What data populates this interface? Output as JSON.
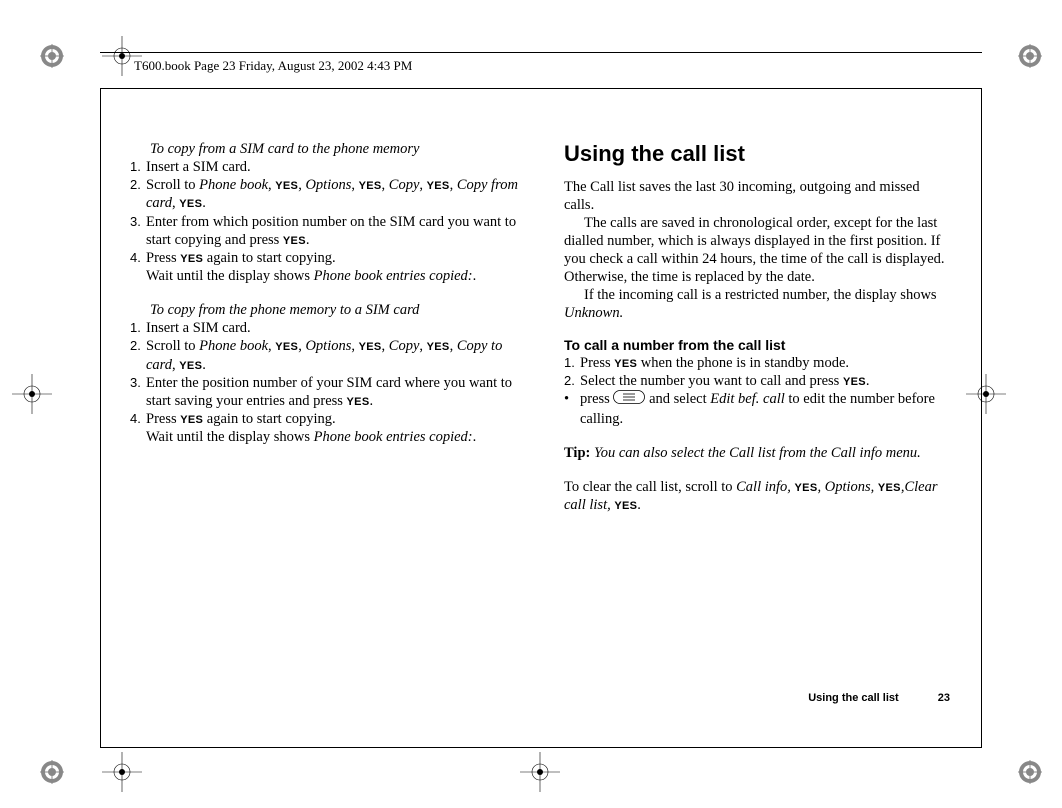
{
  "header": {
    "text": "T600.book  Page 23  Friday, August 23, 2002  4:43 PM"
  },
  "left_col": {
    "sec1": {
      "title": "To copy from a SIM card to the phone memory",
      "step1": "Insert a SIM card.",
      "step2_a": "Scroll to ",
      "step2_pb": "Phone book",
      "step2_b": ", ",
      "step2_opt": "Options",
      "step2_c": ", ",
      "step2_copy": "Copy",
      "step2_d": ", ",
      "step2_cfc": "Copy from card",
      "step2_e": ", ",
      "step2_f": ".",
      "step3_a": "Enter from which position number on the SIM card you want to start copying and press ",
      "step3_b": ".",
      "step4_a": "Press ",
      "step4_b": " again to start copying.",
      "step4_c": "Wait until the display shows ",
      "step4_d": "Phone book entries copied:",
      "step4_e": "."
    },
    "sec2": {
      "title": "To copy from the phone memory to a SIM card",
      "step1": "Insert a SIM card.",
      "step2_a": "Scroll to ",
      "step2_pb": "Phone book",
      "step2_b": ", ",
      "step2_opt": "Options",
      "step2_c": ", ",
      "step2_copy": "Copy",
      "step2_d": ", ",
      "step2_ctc": "Copy to card",
      "step2_e": ", ",
      "step2_f": ".",
      "step3_a": "Enter the position number of your SIM card where you want to start saving your entries and press ",
      "step3_b": ".",
      "step4_a": "Press ",
      "step4_b": " again to start copying.",
      "step4_c": "Wait until the display shows ",
      "step4_d": "Phone book entries copied:",
      "step4_e": "."
    }
  },
  "right_col": {
    "heading": "Using the call list",
    "p1": "The Call list saves the last 30 incoming, outgoing and missed calls.",
    "p2": "The calls are saved in chronological order, except for the last dialled number, which is always displayed in the first position. If you check a call within 24 hours, the time of the call is displayed. Otherwise, the time is replaced by the date.",
    "p3a": "If the incoming call is a restricted number, the display shows ",
    "p3b": "Unknown.",
    "sub": "To call a number from the call list",
    "s1_a": "Press ",
    "s1_b": " when the phone is in standby mode.",
    "s2_a": "Select the number you want to call and press ",
    "s2_b": ".",
    "b1_a": "press ",
    "b1_b": " and select ",
    "b1_c": "Edit bef. call",
    "b1_d": " to edit the number before calling.",
    "tip_label": "Tip:",
    "tip_text": " You can also select the Call list from the Call info menu.",
    "clear_a": "To clear the call list, scroll to ",
    "clear_b": "Call info, ",
    "clear_c": ", Options, ",
    "clear_d": ",",
    "clear_e": "Clear call list, ",
    "clear_f": "."
  },
  "keys": {
    "yes": "YES"
  },
  "footer": {
    "label": "Using the call list",
    "page": "23"
  },
  "nums": {
    "n1": "1.",
    "n2": "2.",
    "n3": "3.",
    "n4": "4.",
    "bull": "•"
  }
}
